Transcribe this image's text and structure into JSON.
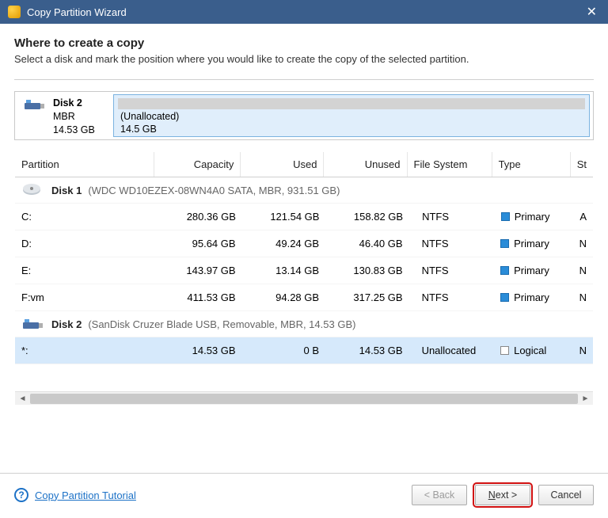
{
  "window": {
    "title": "Copy Partition Wizard"
  },
  "header": {
    "title": "Where to create a copy",
    "subtitle": "Select a disk and mark the position where you would like to create the copy of the selected partition."
  },
  "target_disk": {
    "name": "Disk 2",
    "scheme": "MBR",
    "size": "14.53 GB",
    "segment_label": "(Unallocated)",
    "segment_size": "14.5 GB"
  },
  "table": {
    "headers": {
      "partition": "Partition",
      "capacity": "Capacity",
      "used": "Used",
      "unused": "Unused",
      "fs": "File System",
      "type": "Type",
      "status": "St"
    },
    "disks": [
      {
        "icon": "hdd",
        "name": "Disk 1",
        "desc": "(WDC WD10EZEX-08WN4A0 SATA, MBR, 931.51 GB)",
        "rows": [
          {
            "part": "C:",
            "cap": "280.36 GB",
            "used": "121.54 GB",
            "unused": "158.82 GB",
            "fs": "NTFS",
            "type": "Primary",
            "sq": "blue",
            "st": "A"
          },
          {
            "part": "D:",
            "cap": "95.64 GB",
            "used": "49.24 GB",
            "unused": "46.40 GB",
            "fs": "NTFS",
            "type": "Primary",
            "sq": "blue",
            "st": "N"
          },
          {
            "part": "E:",
            "cap": "143.97 GB",
            "used": "13.14 GB",
            "unused": "130.83 GB",
            "fs": "NTFS",
            "type": "Primary",
            "sq": "blue",
            "st": "N"
          },
          {
            "part": "F:vm",
            "cap": "411.53 GB",
            "used": "94.28 GB",
            "unused": "317.25 GB",
            "fs": "NTFS",
            "type": "Primary",
            "sq": "blue",
            "st": "N"
          }
        ]
      },
      {
        "icon": "usb",
        "name": "Disk 2",
        "desc": "(SanDisk Cruzer Blade USB, Removable, MBR, 14.53 GB)",
        "rows": [
          {
            "part": "*:",
            "cap": "14.53 GB",
            "used": "0 B",
            "unused": "14.53 GB",
            "fs": "Unallocated",
            "type": "Logical",
            "sq": "grey",
            "st": "N",
            "selected": true
          }
        ]
      }
    ]
  },
  "footer": {
    "tutorial": "Copy Partition Tutorial",
    "back": "< Back",
    "next_prefix": "N",
    "next_suffix": "ext >",
    "cancel": "Cancel"
  }
}
